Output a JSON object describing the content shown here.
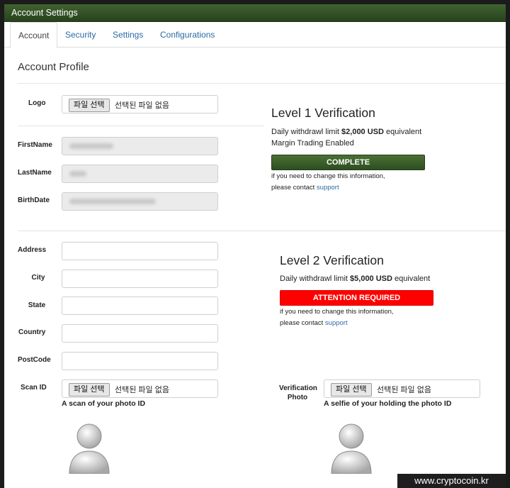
{
  "window": {
    "title": "Account Settings"
  },
  "tabs": [
    {
      "label": "Account",
      "active": true
    },
    {
      "label": "Security"
    },
    {
      "label": "Settings"
    },
    {
      "label": "Configurations"
    }
  ],
  "profile": {
    "title": "Account Profile",
    "logo": {
      "label": "Logo",
      "button": "파일 선택",
      "status": "선택된 파일 없음"
    },
    "firstname": {
      "label": "FirstName"
    },
    "lastname": {
      "label": "LastName"
    },
    "birthdate": {
      "label": "BirthDate"
    },
    "address": {
      "label": "Address",
      "value": ""
    },
    "city": {
      "label": "City",
      "value": ""
    },
    "state": {
      "label": "State",
      "value": ""
    },
    "country": {
      "label": "Country",
      "value": ""
    },
    "postcode": {
      "label": "PostCode",
      "value": ""
    },
    "scan_id": {
      "label": "Scan ID",
      "button": "파일 선택",
      "status": "선택된 파일 없음",
      "caption": "A scan of your photo ID"
    },
    "verification_photo": {
      "label_line1": "Verification",
      "label_line2": "Photo",
      "button": "파일 선택",
      "status": "선택된 파일 없음",
      "caption": "A selfie of your holding the photo ID"
    }
  },
  "level1": {
    "title": "Level 1 Verification",
    "limit_prefix": "Daily withdrawl limit ",
    "limit_amount": "$2,000 USD",
    "limit_suffix": " equivalent",
    "extra": "Margin Trading Enabled",
    "status": "COMPLETE",
    "note_line1": "if you need to change this information,",
    "note_line2_prefix": "please contact ",
    "note_link": "support"
  },
  "level2": {
    "title": "Level 2 Verification",
    "limit_prefix": "Daily withdrawl limit ",
    "limit_amount": "$5,000 USD",
    "limit_suffix": " equivalent",
    "status": "ATTENTION REQUIRED",
    "note_line1": "if you need to change this information,",
    "note_line2_prefix": "please contact ",
    "note_link": "support"
  },
  "watermark": "www.cryptocoin.kr",
  "colors": {
    "complete": "#3a5e2a",
    "attention": "#ff0000",
    "link": "#2b6aa5",
    "titlebar": "#335427"
  }
}
